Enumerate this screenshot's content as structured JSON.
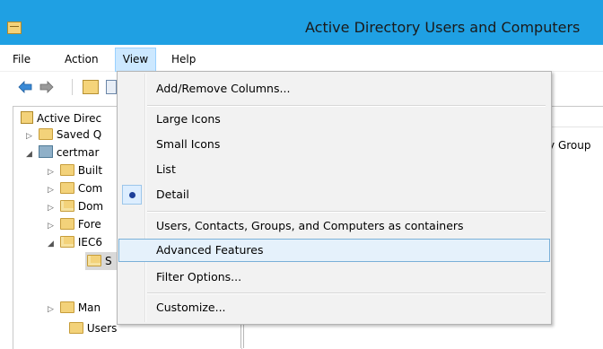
{
  "window": {
    "title": "Active Directory Users and Computers"
  },
  "menubar": {
    "file": "File",
    "action": "Action",
    "view": "View",
    "help": "Help"
  },
  "toolbar": {
    "icons": [
      "back-arrow-icon",
      "forward-arrow-icon",
      "folder-up-icon",
      "document-icon"
    ]
  },
  "tree": {
    "root": "Active Direc",
    "items": [
      {
        "label": "Saved Q",
        "icon": "folder-icon"
      },
      {
        "label": "certmar",
        "icon": "domain-icon"
      },
      {
        "label": "Built",
        "icon": "folder-icon"
      },
      {
        "label": "Com",
        "icon": "folder-icon"
      },
      {
        "label": "Dom",
        "icon": "ou-folder-icon"
      },
      {
        "label": "Fore",
        "icon": "folder-icon"
      },
      {
        "label": "IEC6",
        "icon": "ou-folder-icon"
      },
      {
        "label": "S",
        "icon": "ou-folder-icon"
      },
      {
        "label": "Man",
        "icon": "folder-icon"
      },
      {
        "label": "Users",
        "icon": "folder-icon"
      }
    ]
  },
  "right_pane": {
    "partial_cell": "ity Group"
  },
  "view_menu": {
    "items": [
      {
        "label": "Add/Remove Columns..."
      },
      {
        "label": "Large Icons"
      },
      {
        "label": "Small Icons"
      },
      {
        "label": "List"
      },
      {
        "label": "Detail",
        "selected": true
      },
      {
        "label": "Users, Contacts, Groups, and Computers as containers"
      },
      {
        "label": "Advanced Features",
        "highlighted": true
      },
      {
        "label": "Filter Options..."
      },
      {
        "label": "Customize..."
      }
    ]
  },
  "colors": {
    "titlebar": "#1fa0e3",
    "menu_highlight": "#e5f1fb",
    "radio_dot": "#1c3f9a"
  }
}
